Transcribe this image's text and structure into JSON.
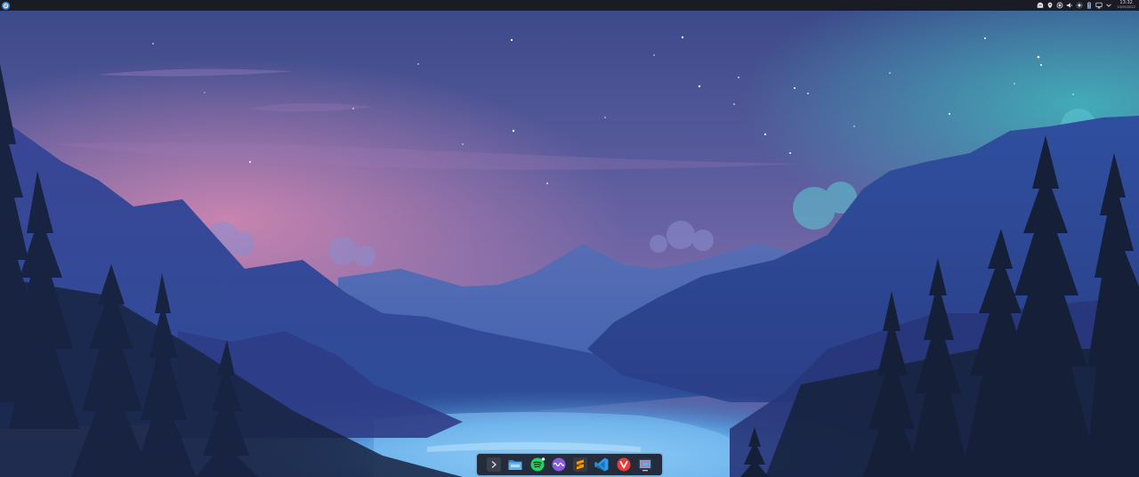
{
  "panel": {
    "launcher_icon": "kde-launcher-icon",
    "clock": {
      "time": "13:32",
      "date": "10/05/2022"
    },
    "tray_icons": [
      "ghost-app-icon",
      "location-pin-icon",
      "record-icon",
      "volume-icon",
      "display-settings-icon",
      "battery-icon",
      "monitor-icon",
      "chevron-down-icon"
    ]
  },
  "dock": {
    "items": [
      {
        "name": "terminal",
        "icon": "terminal-icon"
      },
      {
        "name": "file-manager",
        "icon": "folder-icon"
      },
      {
        "name": "spotify",
        "icon": "spotify-icon"
      },
      {
        "name": "audio-app",
        "icon": "waveform-icon"
      },
      {
        "name": "sublime-text",
        "icon": "sublime-icon"
      },
      {
        "name": "vscode",
        "icon": "vscode-icon"
      },
      {
        "name": "vivaldi",
        "icon": "vivaldi-icon"
      },
      {
        "name": "screenshot-tool",
        "icon": "screenshot-icon"
      }
    ]
  },
  "colors": {
    "panel_bg": "#1a1c25",
    "sky_top": "#3e4a8c",
    "sky_pink": "#c07aa6",
    "lake_glow": "#7fc4f2",
    "aurora": "#45b5c4"
  }
}
